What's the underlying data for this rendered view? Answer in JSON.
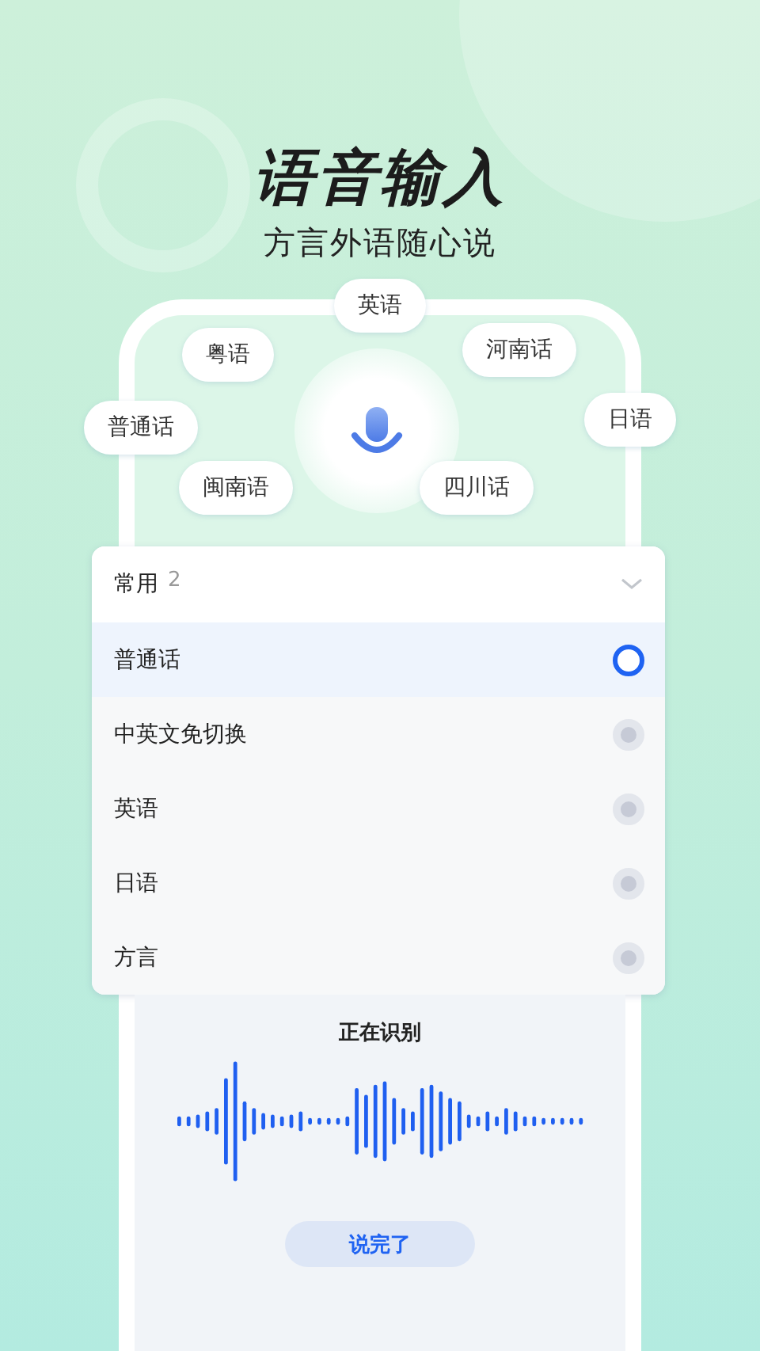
{
  "title": "语音输入",
  "subtitle": "方言外语随心说",
  "bubbles": [
    "英语",
    "粤语",
    "河南话",
    "普通话",
    "日语",
    "闽南语",
    "四川话"
  ],
  "dropdown": {
    "label": "常用",
    "count": "2",
    "options": [
      {
        "label": "普通话",
        "selected": true
      },
      {
        "label": "中英文免切换",
        "selected": false
      },
      {
        "label": "英语",
        "selected": false
      },
      {
        "label": "日语",
        "selected": false
      },
      {
        "label": "方言",
        "selected": false
      }
    ]
  },
  "status": "正在识别",
  "button": "说完了"
}
